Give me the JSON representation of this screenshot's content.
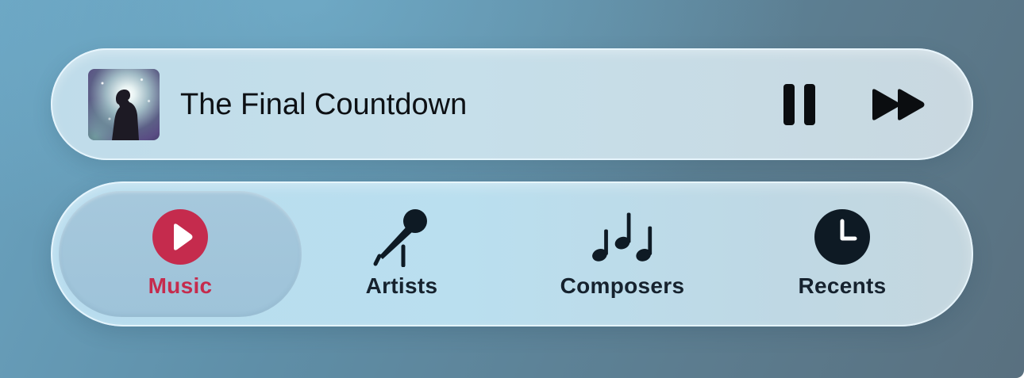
{
  "now_playing": {
    "title": "The Final Countdown",
    "artwork_icon": "album-artwork",
    "pause_icon": "pause-icon",
    "forward_icon": "fast-forward-icon"
  },
  "tabs": [
    {
      "label": "Music",
      "icon": "play-circle-icon",
      "selected": true
    },
    {
      "label": "Artists",
      "icon": "microphone-icon",
      "selected": false
    },
    {
      "label": "Composers",
      "icon": "music-notes-icon",
      "selected": false
    },
    {
      "label": "Recents",
      "icon": "clock-icon",
      "selected": false
    }
  ],
  "colors": {
    "accent": "#c52b4d",
    "icon_dark": "#0e1a24",
    "text_dark": "#16222e"
  }
}
